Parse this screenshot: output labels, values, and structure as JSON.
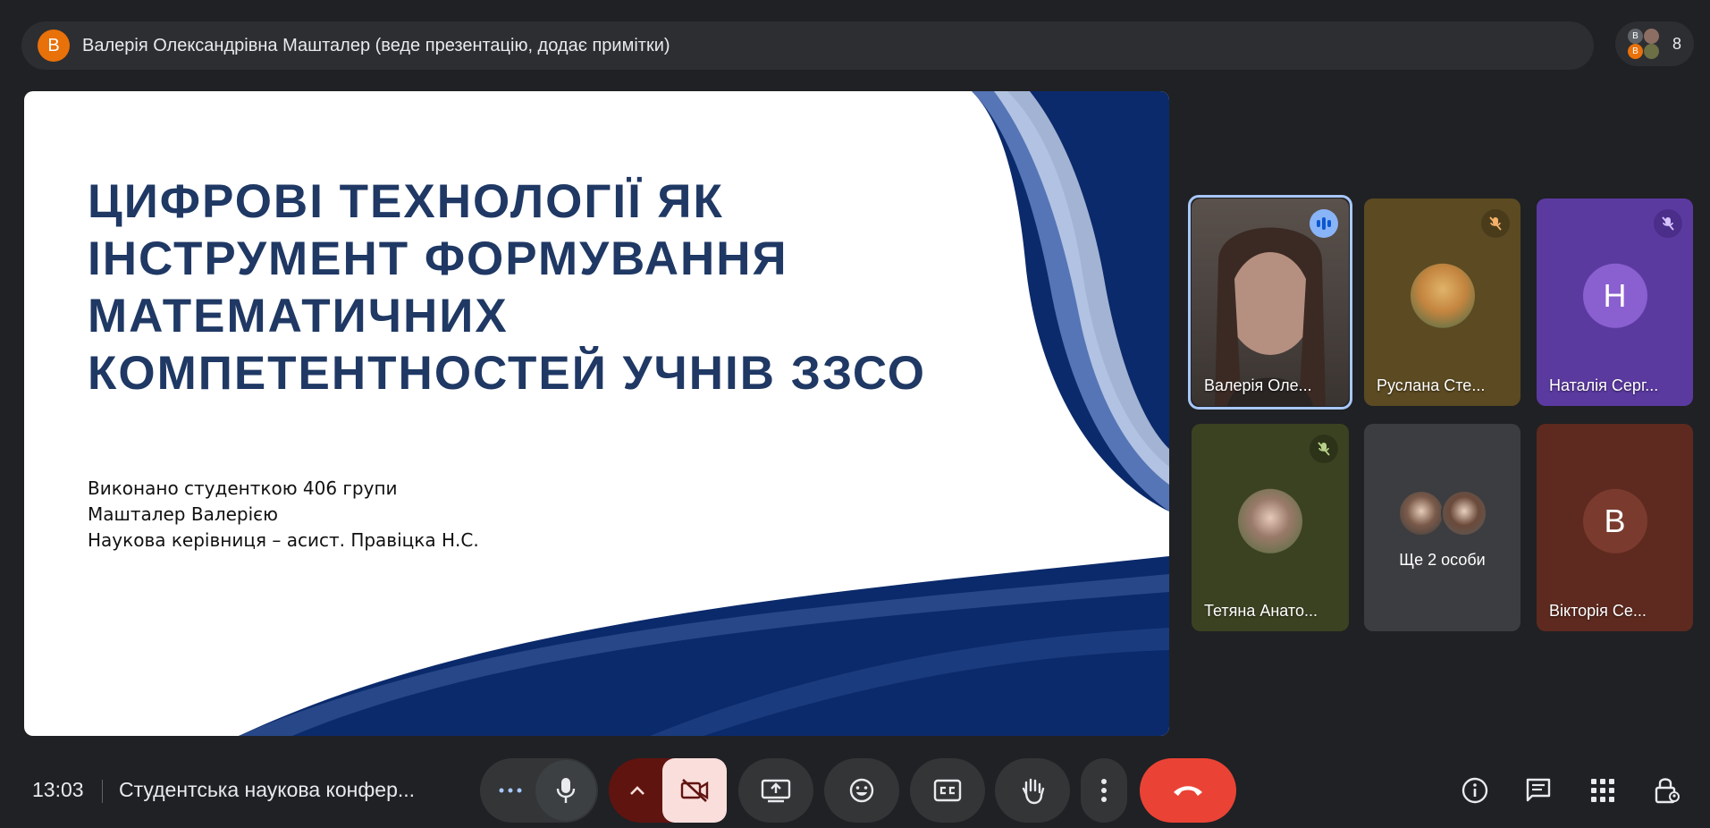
{
  "presenter": {
    "avatar_letter": "В",
    "text": "Валерія Олександрівна Машталер (веде презентацію, додає примітки)"
  },
  "people": {
    "count": "8",
    "mini_avatars": [
      "В",
      "В"
    ]
  },
  "slide": {
    "title_lines": [
      "ЦИФРОВІ ТЕХНОЛОГІЇ ЯК",
      "ІНСТРУМЕНТ ФОРМУВАННЯ",
      "МАТЕМАТИЧНИХ",
      "КОМПЕТЕНТНОСТЕЙ УЧНІВ ЗЗСО"
    ],
    "subtitle_lines": [
      "Виконано студенткою 406 групи",
      "Машталер Валерією",
      "Наукова керівниця – асист. Правіцка Н.С."
    ],
    "title_color": "#1f3864",
    "wave_color": "#0b2a6b"
  },
  "participants": [
    {
      "name": "Валерія Оле...",
      "state": "speaking",
      "bg": "#4a4340"
    },
    {
      "name": "Руслана Сте...",
      "state": "muted",
      "bg": "#5b4a22"
    },
    {
      "name": "Наталія Серг...",
      "state": "muted",
      "letter": "Н",
      "bg": "#5b3aa0",
      "circle": "#8a5fd0"
    },
    {
      "name": "Тетяна Анато...",
      "state": "muted",
      "bg": "#3b4221"
    },
    {
      "name": "Ще 2 особи",
      "state": "group",
      "bg": "#3c3d40"
    },
    {
      "name": "Вікторія Се...",
      "state": "none",
      "letter": "В",
      "bg": "#5e2a1f",
      "circle": "#7a3b2e"
    }
  ],
  "bottom": {
    "time": "13:03",
    "meeting_title": "Студентська наукова конфер..."
  },
  "colors": {
    "end_call": "#ea4335",
    "camera_off_bg": "#f9dedc",
    "camera_off_side": "#601410",
    "active_ring": "#a8c7fa"
  }
}
